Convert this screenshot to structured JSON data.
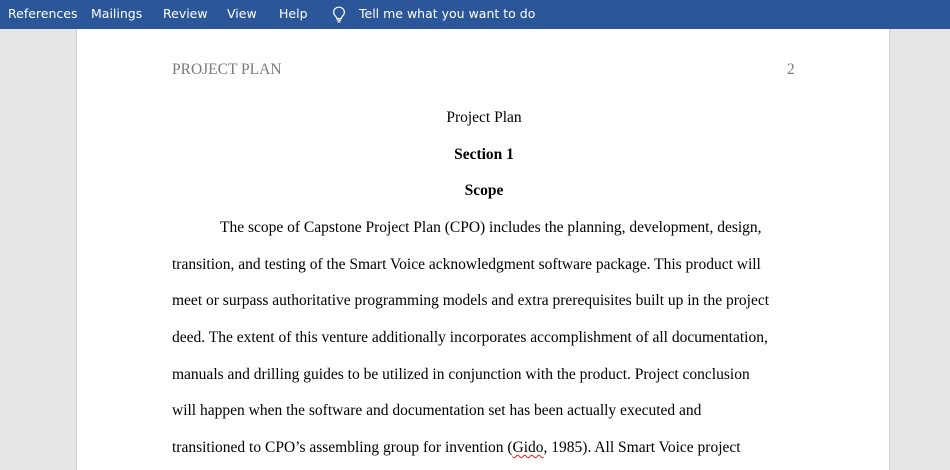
{
  "ribbon": {
    "tabs": [
      "References",
      "Mailings",
      "Review",
      "View",
      "Help"
    ],
    "tell_me": {
      "icon": "lightbulb-icon",
      "text": "Tell me what you want to do"
    },
    "background_color": "#2b579a"
  },
  "document": {
    "header_left": "PROJECT PLAN",
    "page_number": "2",
    "title": "Project Plan",
    "section_heading": "Section 1",
    "scope_heading": "Scope",
    "body_lines": [
      "The scope of Capstone Project Plan (CPO) includes the planning, development, design,",
      "transition, and testing of the Smart Voice acknowledgment software package. This product will",
      "meet or surpass authoritative programming models and extra prerequisites built up in the project",
      "deed. The extent of this venture additionally incorporates accomplishment of all documentation,",
      "manuals and drilling guides to be utilized in conjunction with the product. Project conclusion",
      "will happen when the software and documentation set has been actually executed and"
    ],
    "last_line": {
      "before": "transitioned to CPO’s assembling group for invention (",
      "misspelled": "Gido",
      "after": ", 1985). All Smart Voice project"
    }
  }
}
